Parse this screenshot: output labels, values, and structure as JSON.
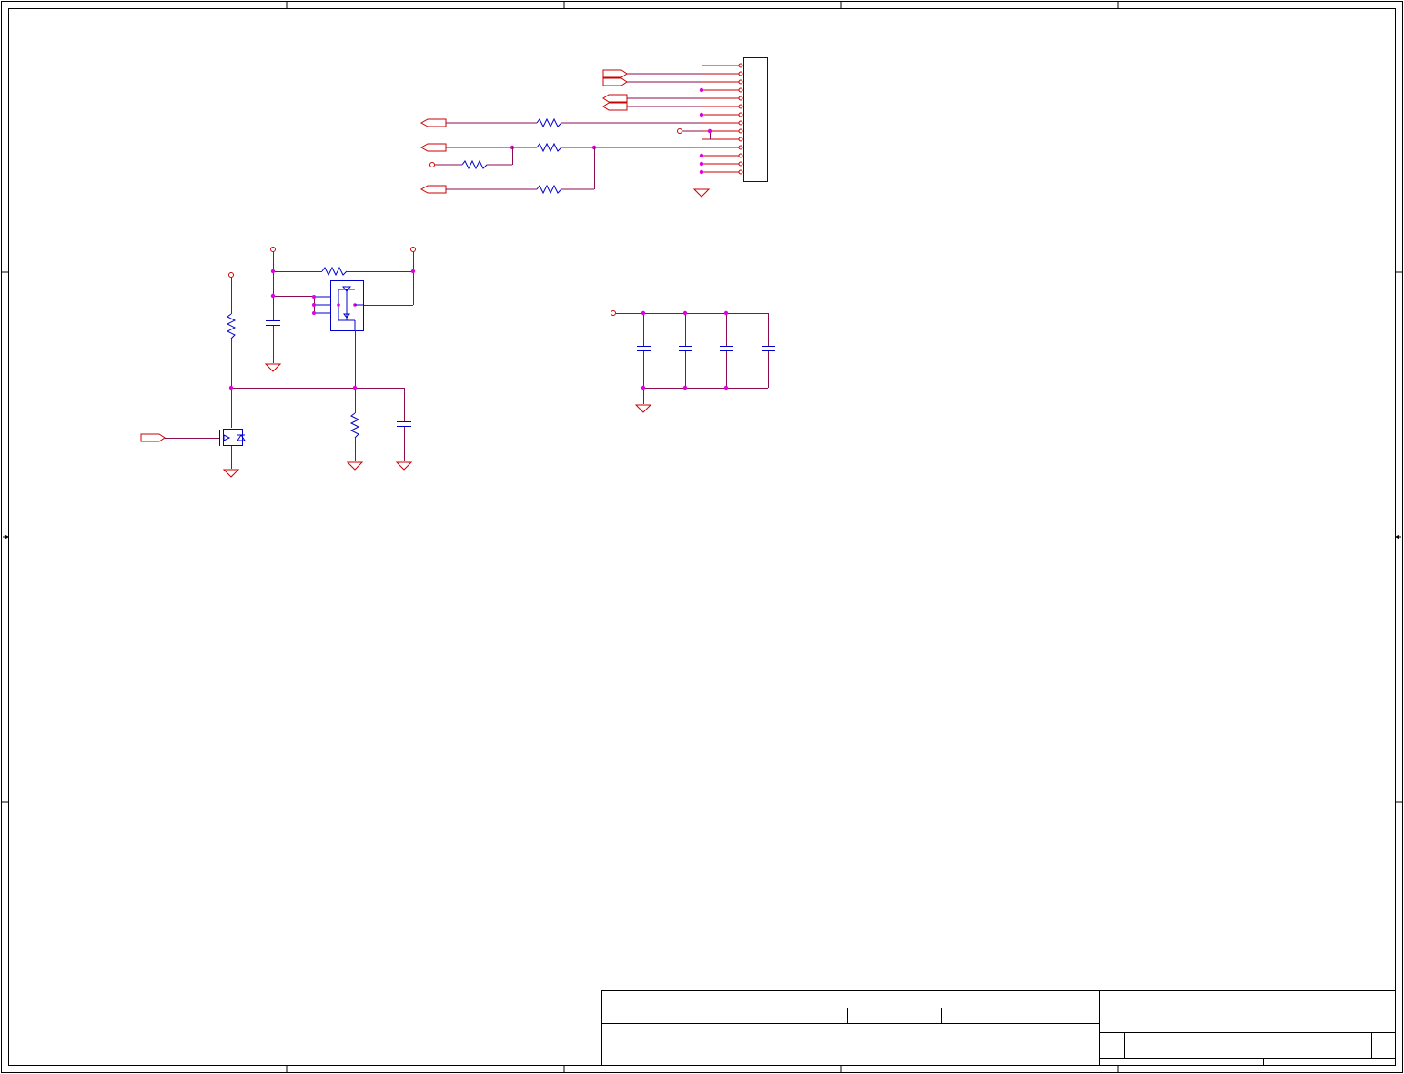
{
  "schematic": {
    "colors": {
      "frame": "#000000",
      "wire": "#8b0a50",
      "pin": "#cc0000",
      "component": "#0000cc",
      "junction": "#e000e0",
      "background": "#ffffff"
    },
    "icons": [
      "resistor-icon",
      "capacitor-icon",
      "ground-icon",
      "off-page-port-icon",
      "power-port-icon",
      "mosfet-icon",
      "connector-icon",
      "junction-dot-icon"
    ],
    "title_block": {}
  }
}
